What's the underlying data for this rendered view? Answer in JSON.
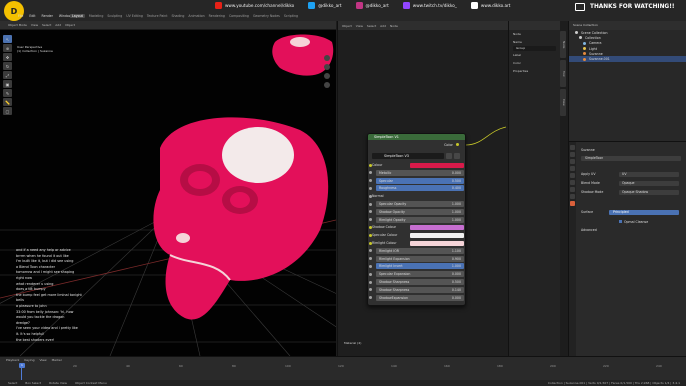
{
  "app": {
    "menus": [
      "File",
      "Edit",
      "Render",
      "Window",
      "Help"
    ],
    "workspace_tabs": [
      "Layout",
      "Modeling",
      "Sculpting",
      "UV Editing",
      "Texture Paint",
      "Shading",
      "Animation",
      "Rendering",
      "Compositing",
      "Geometry Nodes",
      "Scripting"
    ],
    "active_workspace": "Layout"
  },
  "overlay": {
    "social": [
      {
        "icon": "youtube-icon",
        "text": "www.youtube.com/channel/dikko",
        "color": "#e62117"
      },
      {
        "icon": "twitter-icon",
        "text": "@dikko_art",
        "color": "#1da1f2"
      },
      {
        "icon": "instagram-icon",
        "text": "@dikko_art",
        "color": "#c13584"
      },
      {
        "icon": "twitch-icon",
        "text": "www.twitch.tv/dikko_",
        "color": "#9146ff"
      },
      {
        "icon": "web-icon",
        "text": "www.dikko.art",
        "color": "#ffffff"
      }
    ],
    "thanks": "THANKS FOR WATCHING!!"
  },
  "viewport": {
    "header": [
      "Object Mode",
      "View",
      "Select",
      "Add",
      "Object"
    ],
    "info_line1": "User Perspective",
    "info_line2": "(1) Collection | Suzanne",
    "chat": [
      {
        "nick": "",
        "text": "and if a need any help or advice"
      },
      {
        "nick": "",
        "text": "brrrm when he found it out like"
      },
      {
        "nick": "",
        "text": "I'm built like it, but i did see using"
      },
      {
        "nick": "",
        "text": "a Blend Toon character"
      },
      {
        "nick": "",
        "text": "tomorrow and I might see shaping"
      },
      {
        "nick": "",
        "text": "right now"
      },
      {
        "nick": "",
        "text": "what renderer u using"
      },
      {
        "nick": "",
        "text": "does a bit bumpy"
      },
      {
        "nick": "",
        "text": "the bump feel get more liminal tonight"
      },
      {
        "nick": "",
        "text": "bells"
      },
      {
        "nick": "",
        "text": "a pleasure to john"
      },
      {
        "nick": "",
        "text": "33:00 from kelly johnson: 'hi. how"
      },
      {
        "nick": "",
        "text": "would you tackle the dragon"
      },
      {
        "nick": "",
        "text": "dredge?"
      },
      {
        "nick": "",
        "text": "i've seen your video and i pretty like"
      },
      {
        "nick": "",
        "text": "it. It's so helpful!"
      },
      {
        "nick": "",
        "text": "the best shaders ever!"
      }
    ]
  },
  "node_editor": {
    "header": [
      "Object",
      "View",
      "Select",
      "Add",
      "Node"
    ],
    "bottom_label": "Material (4)"
  },
  "node": {
    "title": "SimpleToon V1",
    "output": "Color",
    "group_name": "SimpleToon V3",
    "rows": [
      {
        "label": "Colour",
        "kind": "swatch",
        "color": "#d81a4a"
      },
      {
        "label": "Metallic",
        "kind": "value",
        "value": "0.000"
      },
      {
        "label": "Specular",
        "kind": "value",
        "value": "0.500",
        "highlight": true
      },
      {
        "label": "Roughness",
        "kind": "value",
        "value": "0.400",
        "highlight": true
      },
      {
        "label": "Normal",
        "kind": "label"
      },
      {
        "label": "Specular Opacity",
        "kind": "value",
        "value": "1.000"
      },
      {
        "label": "Shadow Opacity",
        "kind": "value",
        "value": "1.000"
      },
      {
        "label": "Rimlight Opacity",
        "kind": "value",
        "value": "1.000"
      },
      {
        "label": "Shadow Colour",
        "kind": "swatch",
        "color": "#c66ed0"
      },
      {
        "label": "Specular Colour",
        "kind": "swatch",
        "color": "#f1f1f1"
      },
      {
        "label": "Rimlight Colour",
        "kind": "swatch",
        "color": "#f5d4d8"
      },
      {
        "label": "Rimlight IOR",
        "kind": "value",
        "value": "1.100"
      },
      {
        "label": "Rimlight Expansion",
        "kind": "value",
        "value": "0.900"
      },
      {
        "label": "Rimlight Invert",
        "kind": "value",
        "value": "1.000",
        "highlight": true
      },
      {
        "label": "Specular Expansion",
        "kind": "value",
        "value": "0.000"
      },
      {
        "label": "Shadow Sharpness",
        "kind": "value",
        "value": "0.500"
      },
      {
        "label": "Shadow Sharpness",
        "kind": "value",
        "value": "0.140"
      },
      {
        "label": "ShadowExpansion",
        "kind": "value",
        "value": "0.000"
      }
    ]
  },
  "side_panel": {
    "title": "Node",
    "name_label": "Name",
    "name_value": "Group",
    "label_label": "Label",
    "sections": [
      "Color",
      "Properties"
    ]
  },
  "outliner": {
    "title": "Scene Collection",
    "rows": [
      {
        "name": "Scene Collection",
        "icon_color": "#cccccc",
        "selected": false
      },
      {
        "name": "Collection",
        "icon_color": "#cccccc",
        "selected": false
      },
      {
        "name": "Camera",
        "icon_color": "#80b5e0",
        "selected": false
      },
      {
        "name": "Light",
        "icon_color": "#e6c34d",
        "selected": false
      },
      {
        "name": "Suzanne",
        "icon_color": "#e68a3d",
        "selected": false
      },
      {
        "name": "Suzanne.001",
        "icon_color": "#e68a3d",
        "selected": true
      }
    ]
  },
  "properties": {
    "object": "Suzanne",
    "material": "SimpleToon",
    "fields": [
      {
        "label": "Apply UV",
        "value": "UV"
      },
      {
        "label": "Blend Mode",
        "value": "Opaque"
      },
      {
        "label": "Shadow Mode",
        "value": "Opaque Shadow"
      }
    ],
    "surface": "Surface",
    "surface_value": "Principled",
    "checkbox": "Opmal Cleanse",
    "advanced": "Advanced"
  },
  "timeline": {
    "header": [
      "Playback",
      "Keying",
      "View",
      "Marker"
    ],
    "current_frame": "1",
    "ticks": [
      0,
      20,
      40,
      60,
      80,
      100,
      120,
      140,
      160,
      180,
      200,
      220,
      240
    ],
    "start": "1",
    "end": "250"
  },
  "status": {
    "left": [
      "Select",
      "Box Select",
      "Rotate View",
      "Object Context Menu"
    ],
    "right": "Collection | Suzanne.001 | Verts 0/1,507 | Faces 0/1,500 | Tris 2,968 | Objects 1/4 | 3.4.1"
  },
  "colors": {
    "accent": "#4a72b4",
    "node_header": "#3a6b3a",
    "suzanne": "#e3105a"
  }
}
